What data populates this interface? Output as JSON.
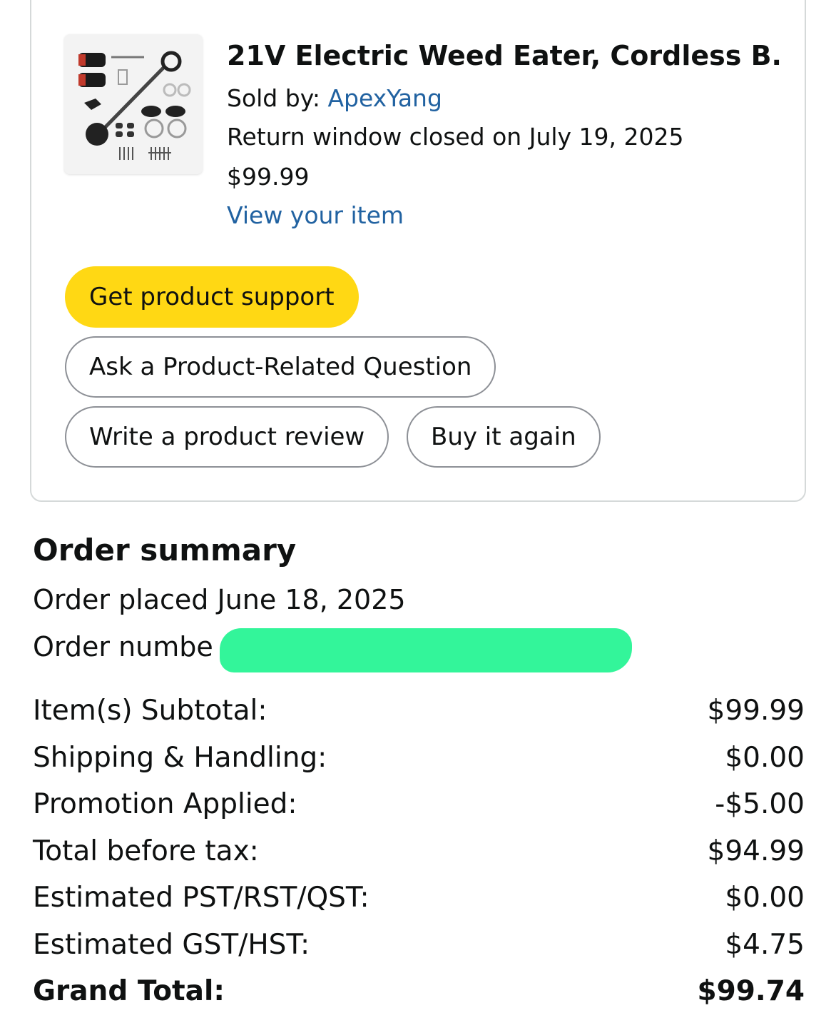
{
  "item": {
    "title": "21V Electric Weed Eater, Cordless B...",
    "sold_by_label": "Sold by: ",
    "seller": "ApexYang",
    "return_window": "Return window closed on July 19, 2025",
    "price": "$99.99",
    "view_item_link": "View your item",
    "image_icon": "product-image"
  },
  "actions": {
    "get_support": "Get product support",
    "ask_question": "Ask a Product-Related Question",
    "write_review": "Write a product review",
    "buy_again": "Buy it again"
  },
  "summary": {
    "title": "Order summary",
    "order_placed": "Order placed June 18, 2025",
    "order_number_label": "Order numbe",
    "rows": [
      {
        "label": "Item(s) Subtotal:",
        "value": "$99.99"
      },
      {
        "label": "Shipping & Handling:",
        "value": "$0.00"
      },
      {
        "label": "Promotion Applied:",
        "value": "-$5.00"
      },
      {
        "label": "Total before tax:",
        "value": "$94.99"
      },
      {
        "label": "Estimated PST/RST/QST:",
        "value": "$0.00"
      },
      {
        "label": "Estimated GST/HST:",
        "value": "$4.75"
      },
      {
        "label": "Grand Total:",
        "value": "$99.74"
      }
    ]
  },
  "colors": {
    "primary_button": "#ffd814",
    "link": "#2162a1",
    "redaction": "#33f59a",
    "border": "#d5d9d9"
  }
}
